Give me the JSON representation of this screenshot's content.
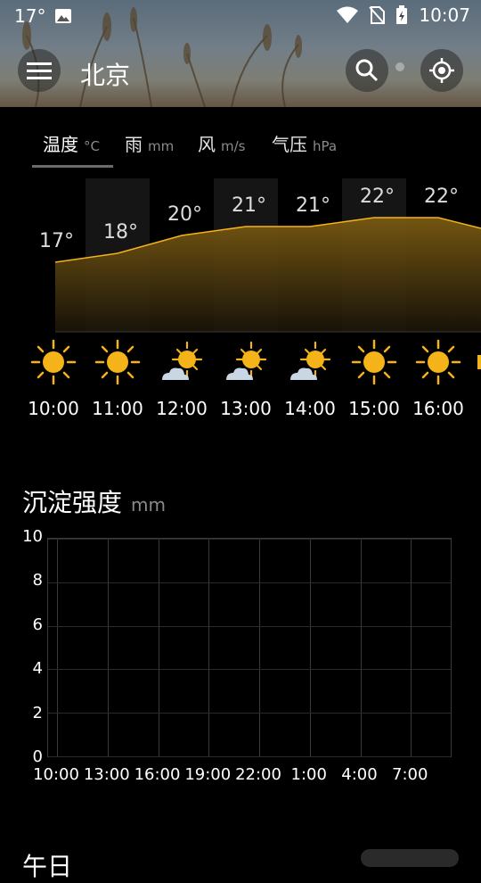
{
  "status_bar": {
    "temp": "17°",
    "time": "10:07"
  },
  "header": {
    "city": "北京"
  },
  "tabs": [
    {
      "label": "温度",
      "unit": "°C",
      "active": true
    },
    {
      "label": "雨",
      "unit": "mm",
      "active": false
    },
    {
      "label": "风",
      "unit": "m/s",
      "active": false
    },
    {
      "label": "气压",
      "unit": "hPa",
      "active": false
    }
  ],
  "hourly": [
    {
      "time": "10:00",
      "temp": "17°",
      "value": 17,
      "icon": "sun-icon"
    },
    {
      "time": "11:00",
      "temp": "18°",
      "value": 18,
      "icon": "sun-icon"
    },
    {
      "time": "12:00",
      "temp": "20°",
      "value": 20,
      "icon": "partly-cloudy-icon"
    },
    {
      "time": "13:00",
      "temp": "21°",
      "value": 21,
      "icon": "partly-cloudy-icon"
    },
    {
      "time": "14:00",
      "temp": "21°",
      "value": 21,
      "icon": "partly-cloudy-icon"
    },
    {
      "time": "15:00",
      "temp": "22°",
      "value": 22,
      "icon": "sun-icon"
    },
    {
      "time": "16:00",
      "temp": "22°",
      "value": 22,
      "icon": "sun-icon"
    }
  ],
  "precip": {
    "title": "沉淀强度",
    "unit": "mm",
    "y_ticks": [
      "0",
      "2",
      "4",
      "6",
      "8",
      "10"
    ],
    "x_ticks": [
      "10:00",
      "13:00",
      "16:00",
      "19:00",
      "22:00",
      "1:00",
      "4:00",
      "7:00"
    ]
  },
  "bottom": {
    "peek_text": "午日"
  },
  "colors": {
    "accent": "#f5b31a",
    "sun": "#f5b31a",
    "cloud": "#c9d6e3"
  }
}
